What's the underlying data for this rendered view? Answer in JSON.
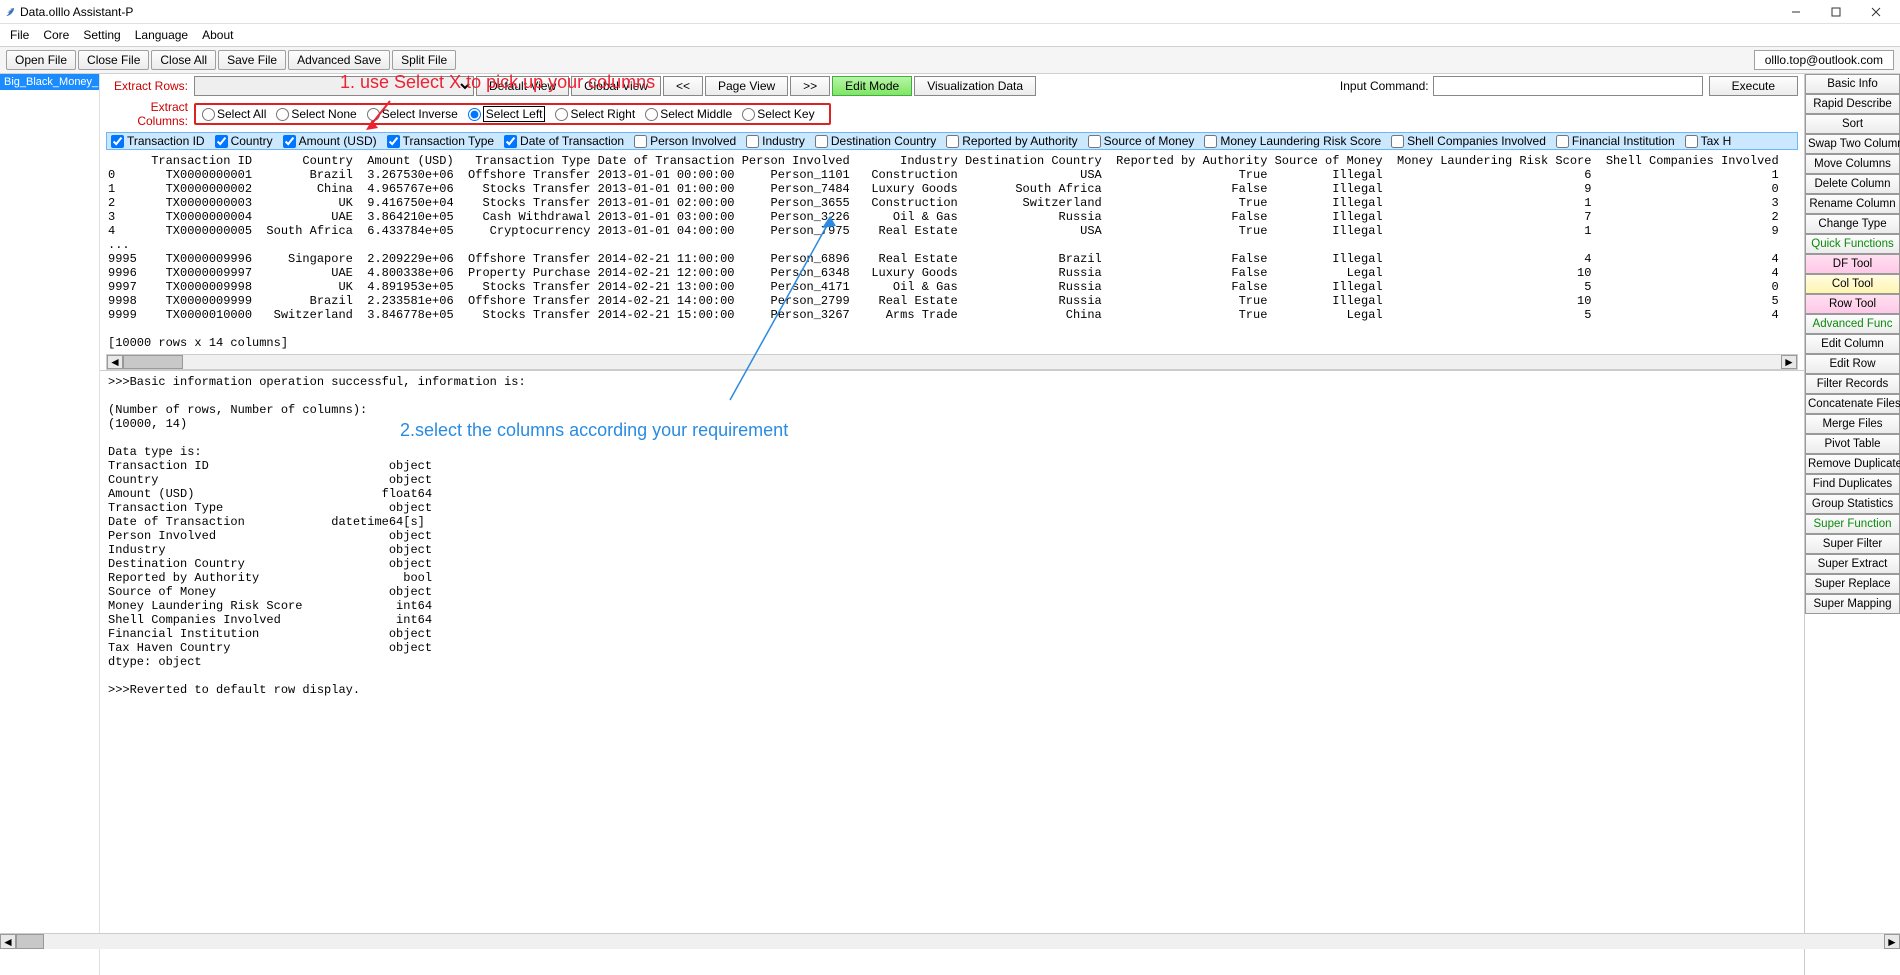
{
  "window": {
    "title": "Data.olllo Assistant-P"
  },
  "menu": [
    "File",
    "Core",
    "Setting",
    "Language",
    "About"
  ],
  "toolbar": {
    "open": "Open File",
    "close": "Close File",
    "closeall": "Close All",
    "save": "Save File",
    "advsave": "Advanced Save",
    "split": "Split File",
    "email": "olllo.top@outlook.com"
  },
  "filetab": "Big_Black_Money_Data",
  "extract_rows_label": "Extract Rows:",
  "viewbtns": {
    "default": "Default View",
    "global": "Global View",
    "prev": "<<",
    "page": "Page View",
    "next": ">>",
    "edit": "Edit Mode",
    "viz": "Visualization Data"
  },
  "inputcmd_label": "Input Command:",
  "execute": "Execute",
  "extract_cols_label": "Extract Columns:",
  "radios": {
    "all": "Select All",
    "none": "Select None",
    "inverse": "Select Inverse",
    "left": "Select Left",
    "right": "Select Right",
    "middle": "Select Middle",
    "key": "Select Key"
  },
  "columns": [
    {
      "name": "Transaction ID",
      "checked": true
    },
    {
      "name": "Country",
      "checked": true
    },
    {
      "name": "Amount (USD)",
      "checked": true
    },
    {
      "name": "Transaction Type",
      "checked": true
    },
    {
      "name": "Date of Transaction",
      "checked": true
    },
    {
      "name": "Person Involved",
      "checked": false
    },
    {
      "name": "Industry",
      "checked": false
    },
    {
      "name": "Destination Country",
      "checked": false
    },
    {
      "name": "Reported by Authority",
      "checked": false
    },
    {
      "name": "Source of Money",
      "checked": false
    },
    {
      "name": "Money Laundering Risk Score",
      "checked": false
    },
    {
      "name": "Shell Companies Involved",
      "checked": false
    },
    {
      "name": "Financial Institution",
      "checked": false
    },
    {
      "name": "Tax H",
      "checked": false
    }
  ],
  "data_header": "      Transaction ID       Country  Amount (USD)   Transaction Type Date of Transaction Person Involved       Industry Destination Country  Reported by Authority Source of Money  Money Laundering Risk Score  Shell Companies Involved",
  "data_rows": [
    "0       TX0000000001        Brazil  3.267530e+06  Offshore Transfer 2013-01-01 00:00:00     Person_1101   Construction                 USA                   True         Illegal                            6                         1",
    "1       TX0000000002         China  4.965767e+06    Stocks Transfer 2013-01-01 01:00:00     Person_7484   Luxury Goods        South Africa                  False         Illegal                            9                         0",
    "2       TX0000000003            UK  9.416750e+04    Stocks Transfer 2013-01-01 02:00:00     Person_3655   Construction         Switzerland                   True         Illegal                            1                         3",
    "3       TX0000000004           UAE  3.864210e+05    Cash Withdrawal 2013-01-01 03:00:00     Person_3226      Oil & Gas              Russia                  False         Illegal                            7                         2",
    "4       TX0000000005  South Africa  6.433784e+05     Cryptocurrency 2013-01-01 04:00:00     Person_7975    Real Estate                 USA                   True         Illegal                            1                         9",
    "...",
    "9995    TX0000009996     Singapore  2.209229e+06  Offshore Transfer 2014-02-21 11:00:00     Person_6896    Real Estate              Brazil                  False         Illegal                            4                         4",
    "9996    TX0000009997           UAE  4.800338e+06  Property Purchase 2014-02-21 12:00:00     Person_6348   Luxury Goods              Russia                  False           Legal                           10                         4",
    "9997    TX0000009998            UK  4.891953e+05    Stocks Transfer 2014-02-21 13:00:00     Person_4171      Oil & Gas              Russia                  False         Illegal                            5                         0",
    "9998    TX0000009999        Brazil  2.233581e+06  Offshore Transfer 2014-02-21 14:00:00     Person_2799    Real Estate              Russia                   True         Illegal                           10                         5",
    "9999    TX0000010000   Switzerland  3.846778e+05    Stocks Transfer 2014-02-21 15:00:00     Person_3267     Arms Trade               China                   True           Legal                            5                         4"
  ],
  "data_footer": "[10000 rows x 14 columns]",
  "anno1": "1. use Select X to pick up your columns",
  "anno2": "2.select the columns according your requirement",
  "info_text": ">>>Basic information operation successful, information is:\n\n(Number of rows, Number of columns):\n(10000, 14)\n\nData type is:\nTransaction ID                         object\nCountry                                object\nAmount (USD)                          float64\nTransaction Type                       object\nDate of Transaction            datetime64[s]\nPerson Involved                        object\nIndustry                               object\nDestination Country                    object\nReported by Authority                    bool\nSource of Money                        object\nMoney Laundering Risk Score             int64\nShell Companies Involved                int64\nFinancial Institution                  object\nTax Haven Country                      object\ndtype: object\n\n>>>Reverted to default row display.",
  "rightbar": [
    {
      "label": "Basic Info"
    },
    {
      "label": "Rapid Describe"
    },
    {
      "label": "Sort"
    },
    {
      "label": "Swap Two Columns"
    },
    {
      "label": "Move Columns"
    },
    {
      "label": "Delete Column"
    },
    {
      "label": "Rename Column"
    },
    {
      "label": "Change Type"
    },
    {
      "label": "Quick Functions",
      "cls": "green"
    },
    {
      "label": "DF Tool",
      "cls": "pink"
    },
    {
      "label": "Col Tool",
      "cls": "yellow"
    },
    {
      "label": "Row Tool",
      "cls": "pink"
    },
    {
      "label": "Advanced Func",
      "cls": "green"
    },
    {
      "label": "Edit Column"
    },
    {
      "label": "Edit Row"
    },
    {
      "label": "Filter Records"
    },
    {
      "label": "Concatenate Files"
    },
    {
      "label": "Merge Files"
    },
    {
      "label": "Pivot Table"
    },
    {
      "label": "Remove Duplicates"
    },
    {
      "label": "Find Duplicates"
    },
    {
      "label": "Group Statistics"
    },
    {
      "label": "Super Function",
      "cls": "green"
    },
    {
      "label": "Super Filter"
    },
    {
      "label": "Super Extract"
    },
    {
      "label": "Super Replace"
    },
    {
      "label": "Super Mapping"
    }
  ]
}
